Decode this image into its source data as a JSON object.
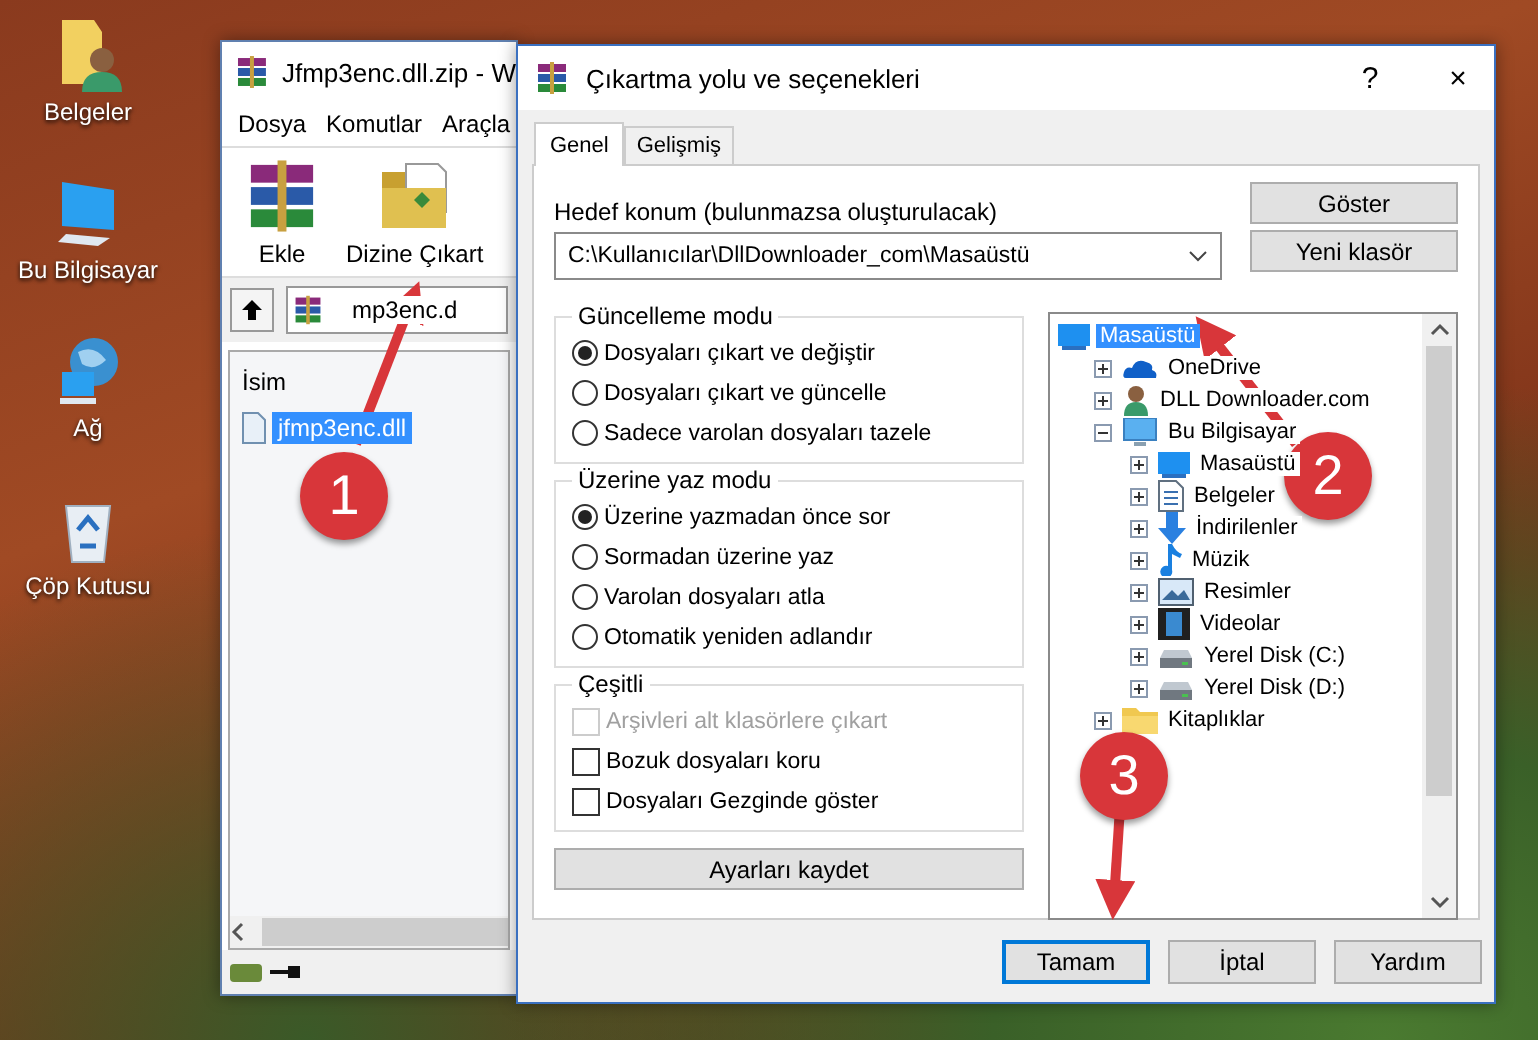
{
  "desktop_icons": [
    {
      "label": "Belgeler",
      "kind": "documents"
    },
    {
      "label": "Bu Bilgisayar",
      "kind": "computer"
    },
    {
      "label": "Ağ",
      "kind": "network"
    },
    {
      "label": "Çöp Kutusu",
      "kind": "bin"
    }
  ],
  "archiver_window": {
    "title": "Jfmp3enc.dll.zip - W",
    "menu": [
      "Dosya",
      "Komutlar",
      "Araçla"
    ],
    "toolbar": [
      {
        "label": "Ekle",
        "kind": "add"
      },
      {
        "label": "Dizine Çıkart",
        "kind": "extract"
      }
    ],
    "address": "mp3enc.d",
    "column": "İsim",
    "files": [
      {
        "name": "jfmp3enc.dll",
        "selected": true
      }
    ]
  },
  "dialog": {
    "title": "Çıkartma yolu ve seçenekleri",
    "help": "?",
    "close": "×",
    "tabs": [
      {
        "label": "Genel",
        "selected": true
      },
      {
        "label": "Gelişmiş",
        "selected": false
      }
    ],
    "destination_label": "Hedef konum (bulunmazsa oluşturulacak)",
    "destination_value": "C:\\Kullanıcılar\\DllDownloader_com\\Masaüstü",
    "side_buttons": [
      "Göster",
      "Yeni klasör"
    ],
    "groups": [
      {
        "title": "Güncelleme modu",
        "kind": "radio",
        "options": [
          {
            "label": "Dosyaları çıkart ve değiştir",
            "selected": true
          },
          {
            "label": "Dosyaları çıkart ve güncelle",
            "selected": false
          },
          {
            "label": "Sadece varolan dosyaları tazele",
            "selected": false
          }
        ]
      },
      {
        "title": "Üzerine yaz modu",
        "kind": "radio",
        "options": [
          {
            "label": "Üzerine yazmadan önce sor",
            "selected": true
          },
          {
            "label": "Sormadan üzerine yaz",
            "selected": false
          },
          {
            "label": "Varolan dosyaları atla",
            "selected": false
          },
          {
            "label": "Otomatik yeniden adlandır",
            "selected": false
          }
        ]
      },
      {
        "title": "Çeşitli",
        "kind": "check",
        "options": [
          {
            "label": "Arşivleri alt klasörlere çıkart",
            "checked": false,
            "disabled": true
          },
          {
            "label": "Bozuk dosyaları koru",
            "checked": false,
            "disabled": false
          },
          {
            "label": "Dosyaları Gezginde göster",
            "checked": false,
            "disabled": false
          }
        ]
      }
    ],
    "save_button": "Ayarları kaydet",
    "tree": [
      {
        "label": "Masaüstü",
        "kind": "desktop",
        "selected": true,
        "children": [
          {
            "label": "OneDrive",
            "kind": "cloud",
            "selected": false,
            "expanded": false
          },
          {
            "label": "DLL Downloader.com",
            "kind": "user",
            "selected": false,
            "expanded": false
          },
          {
            "label": "Bu Bilgisayar",
            "kind": "computer",
            "selected": false,
            "expanded": true,
            "children": [
              {
                "label": "Masaüstü",
                "kind": "desktop",
                "selected": false,
                "expanded": false
              },
              {
                "label": "Belgeler",
                "kind": "document",
                "selected": false,
                "expanded": false
              },
              {
                "label": "İndirilenler",
                "kind": "download",
                "selected": false,
                "expanded": false
              },
              {
                "label": "Müzik",
                "kind": "music",
                "selected": false,
                "expanded": false
              },
              {
                "label": "Resimler",
                "kind": "picture",
                "selected": false,
                "expanded": false
              },
              {
                "label": "Videolar",
                "kind": "video",
                "selected": false,
                "expanded": false
              },
              {
                "label": "Yerel Disk (C:)",
                "kind": "drive",
                "selected": false,
                "expanded": false
              },
              {
                "label": "Yerel Disk (D:)",
                "kind": "drive",
                "selected": false,
                "expanded": false
              }
            ]
          },
          {
            "label": "Kitaplıklar",
            "kind": "folder",
            "selected": false,
            "expanded": false
          }
        ]
      }
    ],
    "buttons": [
      {
        "label": "Tamam",
        "focused": true
      },
      {
        "label": "İptal",
        "focused": false
      },
      {
        "label": "Yardım",
        "focused": false
      }
    ]
  },
  "annotations": [
    "1",
    "2",
    "3"
  ]
}
